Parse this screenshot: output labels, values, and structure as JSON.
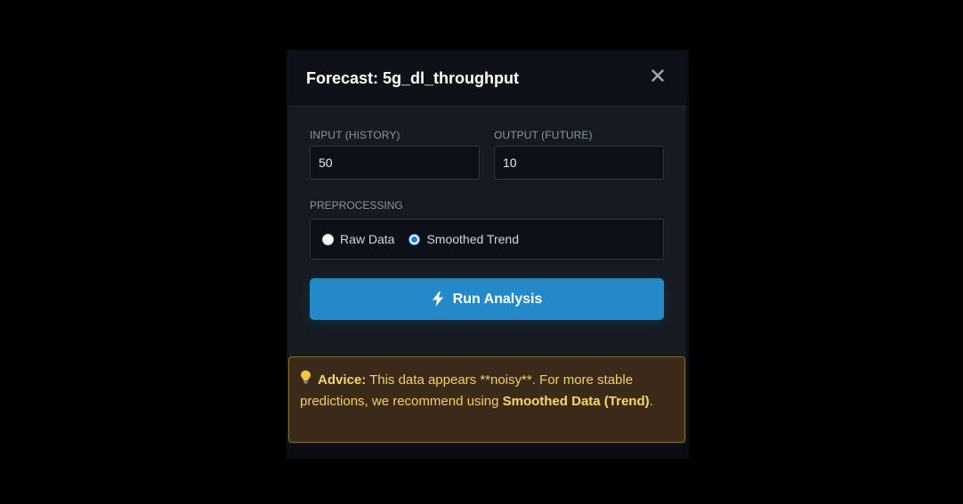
{
  "modal": {
    "title": "Forecast: 5g_dl_throughput",
    "close_icon": "close-icon"
  },
  "form": {
    "input_label": "INPUT (HISTORY)",
    "input_value": "50",
    "output_label": "OUTPUT (FUTURE)",
    "output_value": "10",
    "preprocessing_label": "PREPROCESSING",
    "options": [
      {
        "label": "Raw Data",
        "checked": false
      },
      {
        "label": "Smoothed Trend",
        "checked": true
      }
    ],
    "run_label": "Run Analysis",
    "run_icon": "bolt-icon"
  },
  "advice": {
    "icon": "lightbulb-icon",
    "lead": "Advice:",
    "text_1": " This data appears **noisy**. For more stable predictions, we recommend using ",
    "emphasis": "Smoothed Data (Trend)",
    "text_2": "."
  },
  "colors": {
    "accent": "#2389c9",
    "advice_bg": "#3b2a1a",
    "advice_border": "#8a6d22",
    "advice_text": "#f0d060"
  }
}
